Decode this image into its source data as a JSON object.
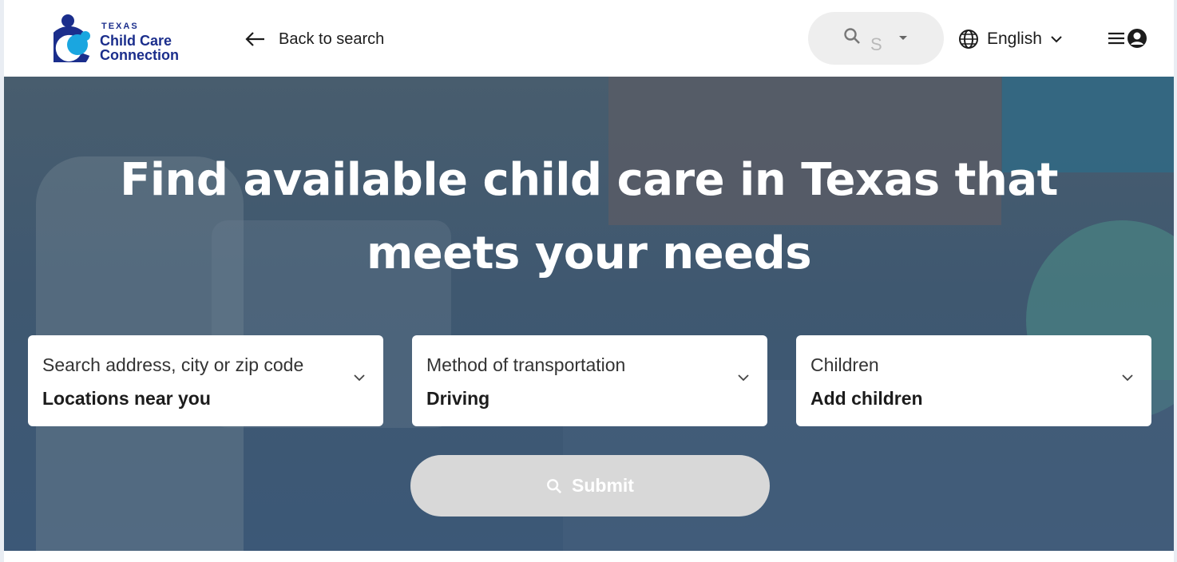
{
  "brand": {
    "line1": "TEXAS",
    "line2": "Child Care",
    "line3": "Connection",
    "colors": {
      "navy": "#1b2e8c",
      "cyan": "#1aa6e0"
    }
  },
  "header": {
    "back_label": "Back to search",
    "search_ghost_text": "S",
    "language": "English",
    "icons": [
      "arrow-left-icon",
      "search-icon",
      "caret-down-icon",
      "globe-icon",
      "chevron-down-icon",
      "hamburger-icon",
      "account-icon"
    ]
  },
  "hero": {
    "title_line1": "Find available child care in Texas that",
    "title_line2": "meets your needs",
    "fields": [
      {
        "label": "Search address, city or zip code",
        "value": "Locations near you"
      },
      {
        "label": "Method of transportation",
        "value": "Driving"
      },
      {
        "label": "Children",
        "value": "Add children"
      }
    ],
    "submit_label": "Submit"
  }
}
